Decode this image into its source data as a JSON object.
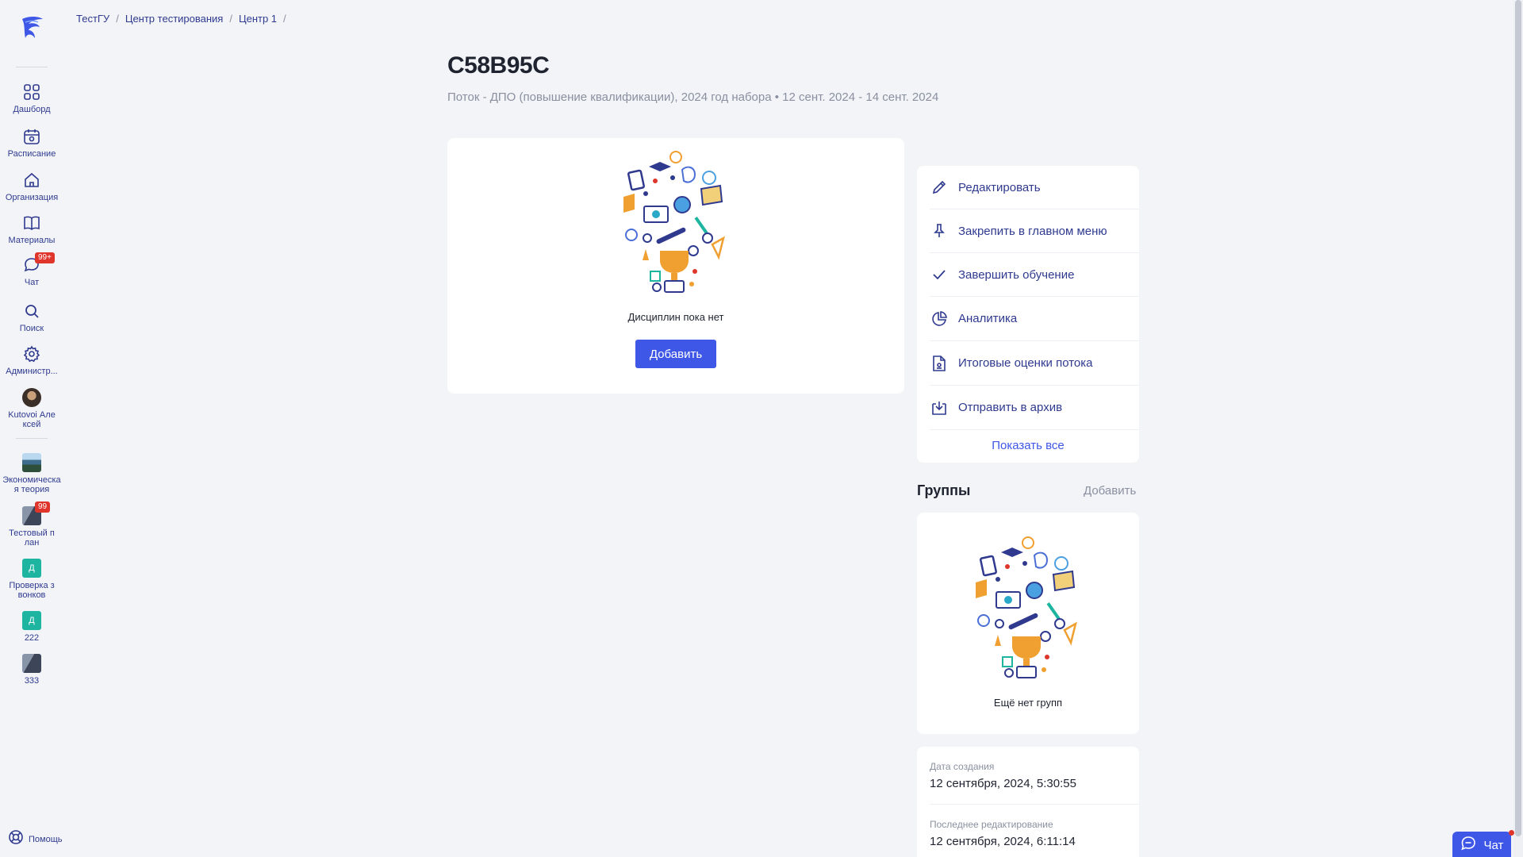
{
  "colors": {
    "accent": "#3e57e6",
    "nav_text": "#2f3a8f",
    "badge": "#e0352b",
    "muted": "#8a90a0"
  },
  "sidebar": {
    "items": [
      {
        "label": "Дашборд",
        "icon": "grid-icon"
      },
      {
        "label": "Расписание",
        "icon": "calendar-icon"
      },
      {
        "label": "Организация",
        "icon": "home-icon"
      },
      {
        "label": "Материалы",
        "icon": "book-icon"
      },
      {
        "label": "Чат",
        "icon": "chat-icon",
        "badge": "99+"
      },
      {
        "label": "Поиск",
        "icon": "search-icon"
      },
      {
        "label": "Администр...",
        "icon": "gear-icon"
      }
    ],
    "user": {
      "name": "Kutovoi Алексей"
    },
    "courses": [
      {
        "label": "Экономическая теория"
      },
      {
        "label": "Тестовый план",
        "badge": "99"
      },
      {
        "label": "Проверка звонков",
        "initial": "Д"
      },
      {
        "label": "222",
        "initial": "Д"
      },
      {
        "label": "333"
      }
    ],
    "help_label": "Помощь"
  },
  "breadcrumb": [
    "ТестГУ",
    "Центр тестирования",
    "Центр 1"
  ],
  "header": {
    "title": "C58B95C",
    "subtitle": "Поток - ДПО (повышение квалификации), 2024 год набора • 12 сент. 2024 - 14 сент. 2024"
  },
  "disciplines": {
    "empty_text": "Дисциплин пока нет",
    "add_label": "Добавить"
  },
  "actions": [
    {
      "label": "Редактировать",
      "icon": "pencil-icon"
    },
    {
      "label": "Закрепить в главном меню",
      "icon": "pin-icon"
    },
    {
      "label": "Завершить обучение",
      "icon": "check-icon"
    },
    {
      "label": "Аналитика",
      "icon": "pie-chart-icon"
    },
    {
      "label": "Итоговые оценки потока",
      "icon": "document-icon"
    },
    {
      "label": "Отправить в архив",
      "icon": "archive-icon"
    }
  ],
  "show_all_label": "Показать все",
  "groups": {
    "title": "Группы",
    "add_label": "Добавить",
    "empty_text": "Ещё нет групп"
  },
  "info": {
    "created_label": "Дата создания",
    "created_value": "12 сентября, 2024, 5:30:55",
    "edited_label": "Последнее редактирование",
    "edited_value": "12 сентября, 2024, 6:11:14"
  },
  "chat_fab": {
    "label": "Чат"
  }
}
